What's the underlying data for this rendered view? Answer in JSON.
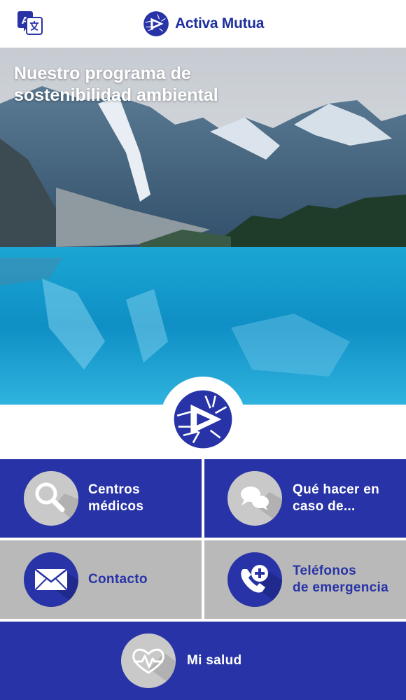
{
  "header": {
    "brand_name": "Activa Mutua",
    "translate_icon": "translate-icon",
    "logo_icon": "activa-mutua-logo"
  },
  "hero": {
    "title": "Nuestro programa de sostenibilidad ambiental"
  },
  "tiles": {
    "centros": {
      "label_line1": "Centros",
      "label_line2": "médicos",
      "icon": "search-icon"
    },
    "que_hacer": {
      "label_line1": "Qué hacer en",
      "label_line2": "caso de...",
      "icon": "chat-icon"
    },
    "contacto": {
      "label": "Contacto",
      "icon": "envelope-icon"
    },
    "telefonos": {
      "label_line1": "Teléfonos",
      "label_line2": "de emergencia",
      "icon": "phone-plus-icon"
    },
    "mi_salud": {
      "label": "Mi salud",
      "icon": "heart-pulse-icon"
    }
  },
  "colors": {
    "brand_blue": "#2733a6",
    "tile_gray": "#b9b9b9",
    "circle_gray": "#c9c9c9"
  }
}
